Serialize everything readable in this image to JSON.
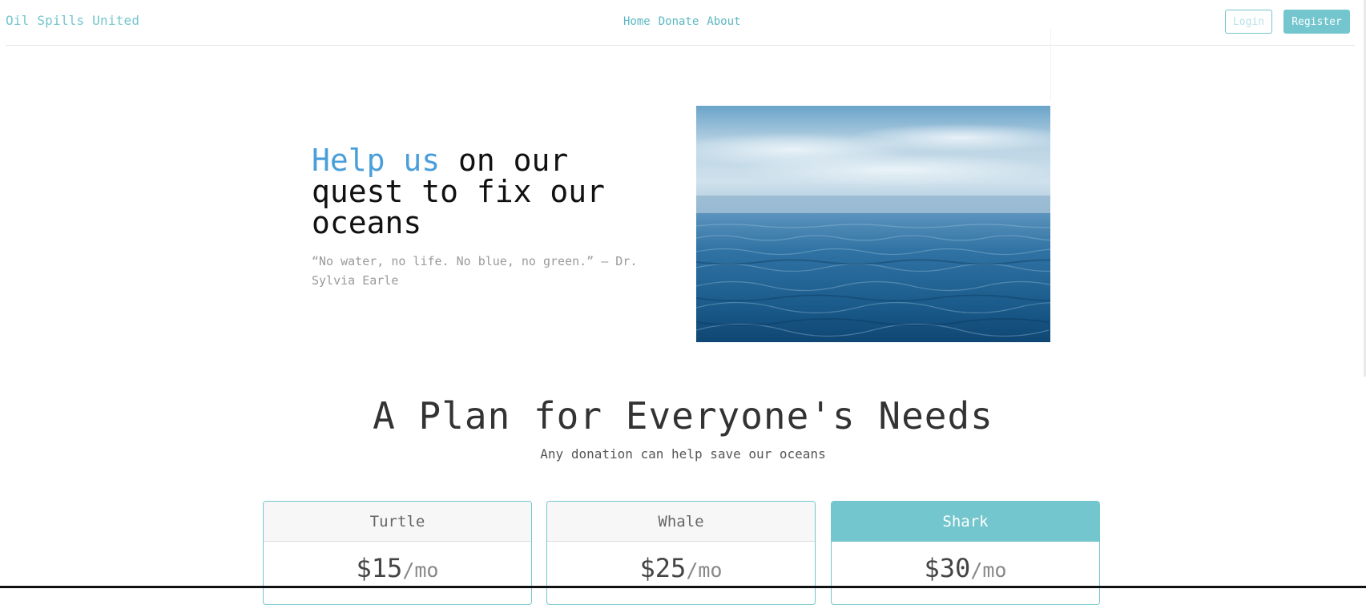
{
  "navbar": {
    "brand": "Oil Spills United",
    "links": [
      "Home",
      "Donate",
      "About"
    ],
    "login_label": "Login",
    "register_label": "Register"
  },
  "hero": {
    "title_accent": "Help us",
    "title_rest": " on our quest to fix our oceans",
    "quote": "“No water, no life. No blue, no green.” – Dr. Sylvia Earle",
    "image_icon": "ocean-photo"
  },
  "plans": {
    "title": "A Plan for Everyone's Needs",
    "subtitle": "Any donation can help save our oceans",
    "cards": [
      {
        "name": "Turtle",
        "price": "$15",
        "period": "/mo"
      },
      {
        "name": "Whale",
        "price": "$25",
        "period": "/mo"
      },
      {
        "name": "Shark",
        "price": "$30",
        "period": "/mo"
      }
    ]
  },
  "colors": {
    "accent": "#73c6cd",
    "title_accent": "#4a9fda",
    "brand": "#73c6cd"
  }
}
